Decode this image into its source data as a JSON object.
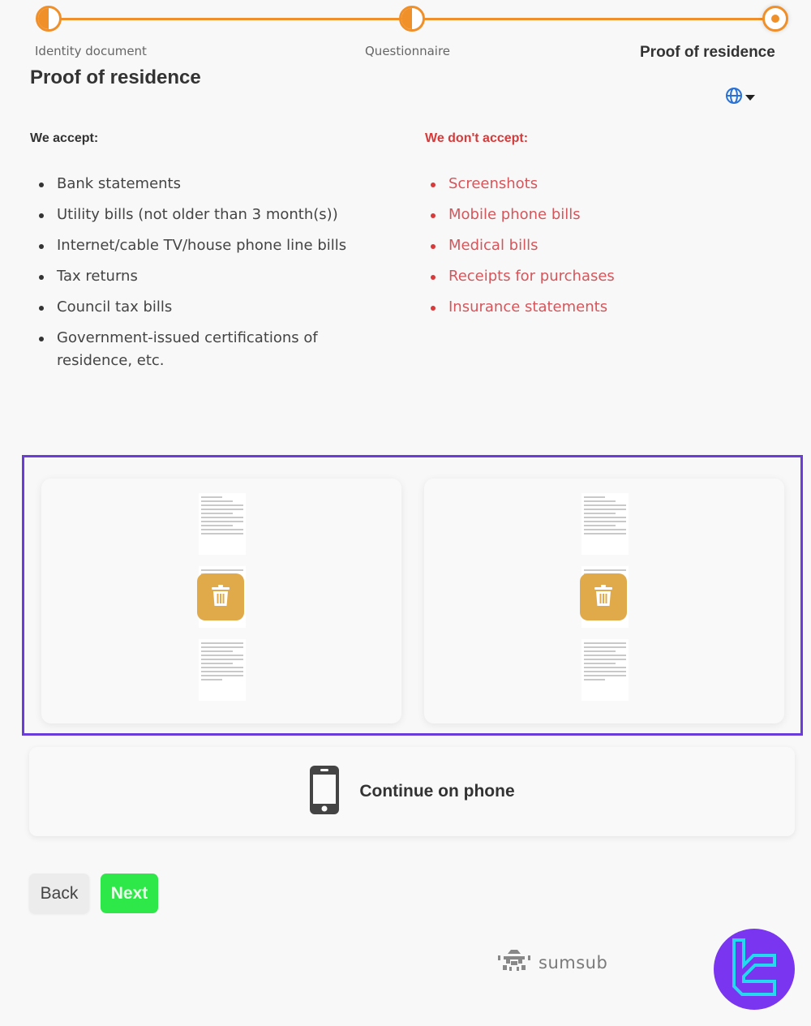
{
  "stepper": {
    "steps": [
      {
        "label": "Identity document",
        "state": "completed"
      },
      {
        "label": "Questionnaire",
        "state": "completed"
      },
      {
        "label": "Proof of residence",
        "state": "current"
      }
    ],
    "accent_color": "#f0902a"
  },
  "header": {
    "title": "Proof of residence",
    "language_icon": "globe-icon"
  },
  "accept": {
    "heading": "We accept:",
    "items": [
      "Bank statements",
      "Utility bills (not older than 3 month(s))",
      "Internet/cable TV/house phone line bills",
      "Tax returns",
      "Council tax bills",
      "Government-issued certifications of residence, etc."
    ]
  },
  "reject": {
    "heading": "We don't accept:",
    "color": "#d63a3a",
    "items": [
      "Screenshots",
      "Mobile phone bills",
      "Medical bills",
      "Receipts for purchases",
      "Insurance statements"
    ]
  },
  "uploads": {
    "highlight_color": "#6a3ddb",
    "documents": [
      {
        "name": "uploaded-document-1",
        "action_icon": "trash-icon"
      },
      {
        "name": "uploaded-document-2",
        "action_icon": "trash-icon"
      }
    ]
  },
  "phone": {
    "label": "Continue on phone",
    "icon": "smartphone-icon"
  },
  "actions": {
    "back_label": "Back",
    "next_label": "Next"
  },
  "footer": {
    "powered_by": "sumsub"
  }
}
